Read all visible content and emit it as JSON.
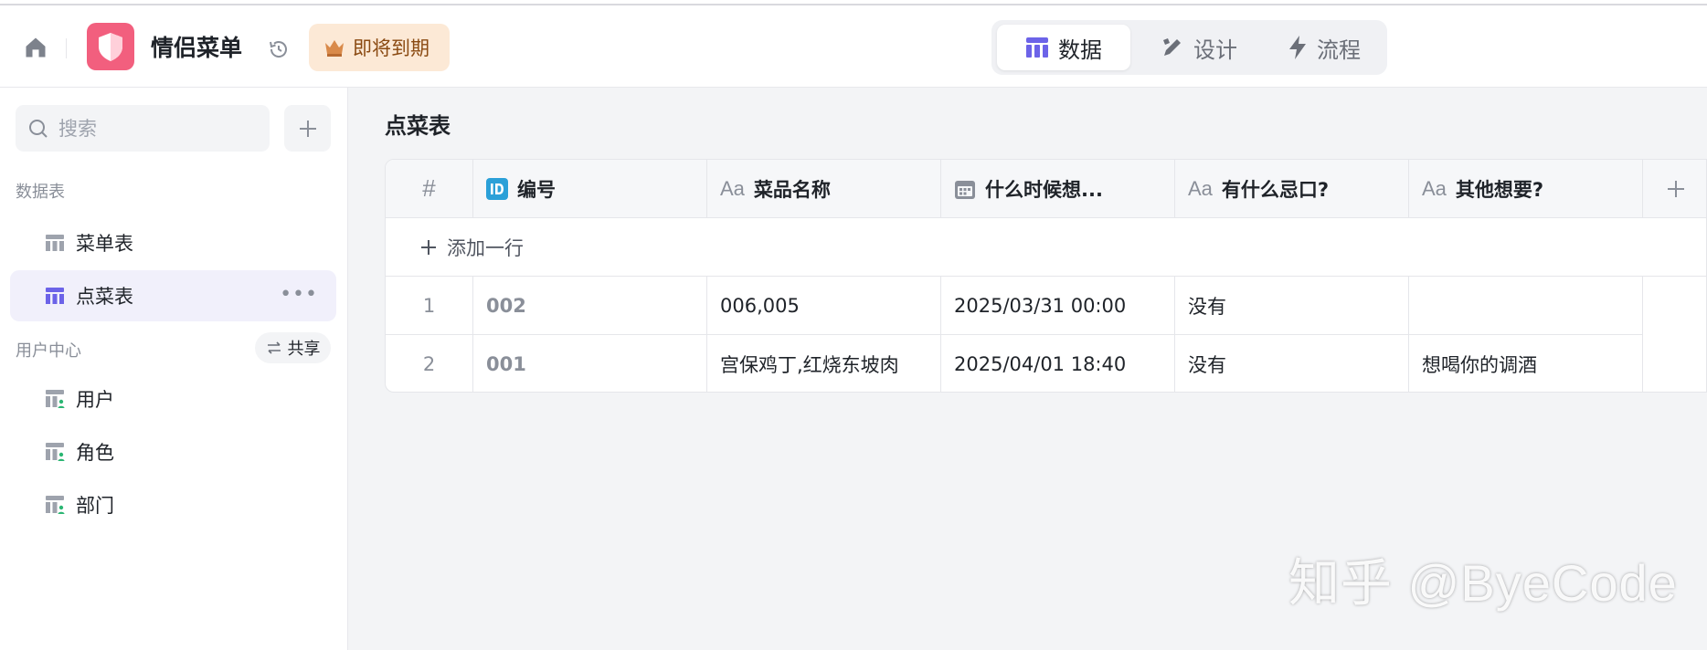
{
  "header": {
    "app_title": "情侣菜单",
    "expire_badge": "即将到期",
    "tabs": [
      {
        "label": "数据",
        "active": true
      },
      {
        "label": "设计",
        "active": false
      },
      {
        "label": "流程",
        "active": false
      }
    ]
  },
  "sidebar": {
    "search_placeholder": "搜索",
    "section_data_tables": "数据表",
    "data_tables": [
      {
        "label": "菜单表",
        "active": false
      },
      {
        "label": "点菜表",
        "active": true
      }
    ],
    "section_user_center": "用户中心",
    "share_label": "共享",
    "user_center_items": [
      {
        "label": "用户"
      },
      {
        "label": "角色"
      },
      {
        "label": "部门"
      }
    ]
  },
  "main": {
    "table_title": "点菜表",
    "columns": [
      {
        "label": "#",
        "type": "index"
      },
      {
        "label": "编号",
        "type": "id"
      },
      {
        "label": "菜品名称",
        "type": "text",
        "prefix": "Aa"
      },
      {
        "label": "什么时候想...",
        "type": "date"
      },
      {
        "label": "有什么忌口?",
        "type": "text",
        "prefix": "Aa"
      },
      {
        "label": "其他想要?",
        "type": "text",
        "prefix": "Aa"
      }
    ],
    "add_row_label": "添加一行",
    "rows": [
      {
        "index": "1",
        "id": "002",
        "dish": "006,005",
        "when": "2025/03/31 00:00",
        "avoid": "没有",
        "other": ""
      },
      {
        "index": "2",
        "id": "001",
        "dish": "宫保鸡丁,红烧东坡肉",
        "when": "2025/04/01 18:40",
        "avoid": "没有",
        "other": "想喝你的调酒"
      }
    ]
  },
  "watermark": "知乎 @ByeCode",
  "colors": {
    "accent": "#6c63e8",
    "logo_bg": "#f25f7e",
    "badge_bg": "#fce9d6",
    "id_icon": "#2ba0d8"
  }
}
